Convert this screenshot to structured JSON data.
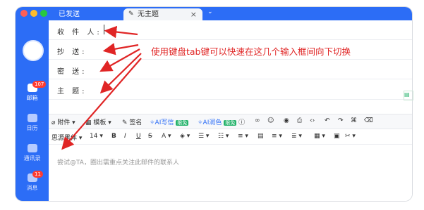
{
  "tabs": {
    "sent_label": "已发送",
    "active_label": "无主题",
    "close_icon": "×",
    "dropdown_icon": "⌄"
  },
  "sidebar": {
    "mail_label": "邮箱",
    "mail_badge": "107",
    "calendar_label": "日历",
    "contacts_label": "通讯录",
    "messages_label": "消息",
    "messages_badge": "11"
  },
  "compose": {
    "to_label": "收 件 人:",
    "cc_label": "抄  送:",
    "bcc_label": "密  送:",
    "subject_label": "主  题:"
  },
  "toolbar1": {
    "attach": "附件",
    "template": "模板",
    "signature": "签名",
    "ai_write": "AI写信",
    "ai_write_tag": "限免",
    "ai_polish": "AI润色",
    "ai_polish_tag": "限免"
  },
  "toolbar2": {
    "font_family": "思源黑体",
    "font_size": "14",
    "bold": "B",
    "italic": "I",
    "underline": "U",
    "strike": "S"
  },
  "editor": {
    "placeholder": "尝试@TA，圈出需重点关注此邮件的联系人"
  },
  "annotation": {
    "text": "使用键盘tab键可以快速在这几个输入框间向下切换"
  },
  "colors": {
    "brand_blue": "#2c6df6",
    "annotation_red": "#e02525",
    "tag_green": "#26b36c"
  }
}
